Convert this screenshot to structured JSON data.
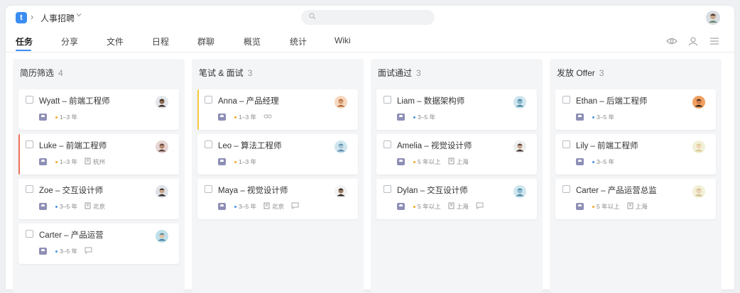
{
  "header": {
    "app_icon_letter": "t",
    "project_title": "人事招聘"
  },
  "tabs": [
    {
      "label": "任务",
      "active": true
    },
    {
      "label": "分享",
      "active": false
    },
    {
      "label": "文件",
      "active": false
    },
    {
      "label": "日程",
      "active": false
    },
    {
      "label": "群聊",
      "active": false
    },
    {
      "label": "概览",
      "active": false
    },
    {
      "label": "统计",
      "active": false
    },
    {
      "label": "Wiki",
      "active": false
    }
  ],
  "colors": {
    "accent": "#3b8cf0",
    "dot_orange": "#f5a623",
    "dot_blue": "#4a90e2",
    "bar_red": "#f0705a",
    "bar_yellow": "#f5c842"
  },
  "columns": [
    {
      "title": "简历筛选",
      "count": "4",
      "cards": [
        {
          "title": "Wyatt – 前端工程师",
          "exp": "1–3 年",
          "exp_dot": "orange",
          "location": "",
          "extra": "",
          "bar": ""
        },
        {
          "title": "Luke – 前端工程师",
          "exp": "1–3 年",
          "exp_dot": "orange",
          "location": "杭州",
          "extra": "",
          "bar": "red"
        },
        {
          "title": "Zoe – 交互设计师",
          "exp": "3–5 年",
          "exp_dot": "blue",
          "location": "北京",
          "extra": "",
          "bar": ""
        },
        {
          "title": "Carter – 产品运营",
          "exp": "3–5 年",
          "exp_dot": "blue",
          "location": "",
          "extra": "comment",
          "bar": ""
        }
      ]
    },
    {
      "title": "笔试 & 面试",
      "count": "3",
      "cards": [
        {
          "title": "Anna – 产品经理",
          "exp": "1–3 年",
          "exp_dot": "orange",
          "location": "",
          "extra": "link",
          "bar": "yellow"
        },
        {
          "title": "Leo – 算法工程师",
          "exp": "1–3 年",
          "exp_dot": "orange",
          "location": "",
          "extra": "",
          "bar": ""
        },
        {
          "title": "Maya – 视觉设计师",
          "exp": "3–5 年",
          "exp_dot": "blue",
          "location": "北京",
          "extra": "comment",
          "bar": ""
        }
      ]
    },
    {
      "title": "面试通过",
      "count": "3",
      "cards": [
        {
          "title": "Liam – 数据架构师",
          "exp": "3–5 年",
          "exp_dot": "blue",
          "location": "",
          "extra": "",
          "bar": ""
        },
        {
          "title": "Amelia – 视觉设计师",
          "exp": "5 年以上",
          "exp_dot": "orange",
          "location": "上海",
          "extra": "",
          "bar": ""
        },
        {
          "title": "Dylan – 交互设计师",
          "exp": "5 年以上",
          "exp_dot": "orange",
          "location": "上海",
          "extra": "comment",
          "bar": ""
        }
      ]
    },
    {
      "title": "发放 Offer",
      "count": "3",
      "cards": [
        {
          "title": "Ethan – 后端工程师",
          "exp": "3–5 年",
          "exp_dot": "blue",
          "location": "",
          "extra": "",
          "bar": ""
        },
        {
          "title": "Lily – 前端工程师",
          "exp": "3–5 年",
          "exp_dot": "blue",
          "location": "",
          "extra": "",
          "bar": ""
        },
        {
          "title": "Carter – 产品运营总监",
          "exp": "5 年以上",
          "exp_dot": "orange",
          "location": "上海",
          "extra": "",
          "bar": ""
        }
      ]
    }
  ]
}
